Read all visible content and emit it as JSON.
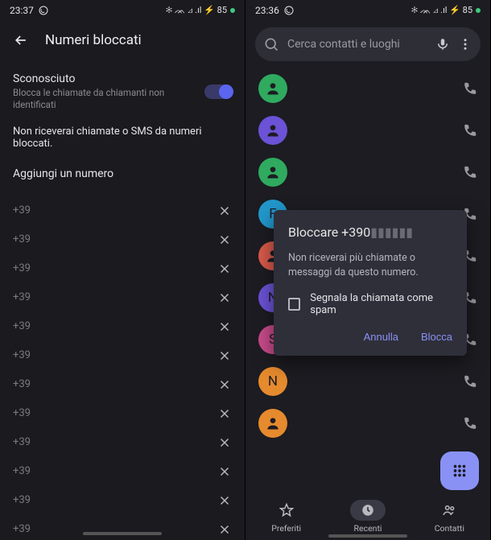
{
  "left": {
    "status": {
      "time": "23:37",
      "icons": "✻ ᨏ ⊿ .ıl ⚡ 85"
    },
    "title": "Numeri bloccati",
    "toggle": {
      "title": "Sconosciuto",
      "subtitle": "Blocca le chiamate da chiamanti non identificati"
    },
    "info": "Non riceverai chiamate o SMS da numeri bloccati.",
    "add_label": "Aggiungi un numero",
    "numbers": [
      "+39",
      "+39",
      "+39",
      "+39",
      "+39",
      "+39",
      "+39",
      "+39",
      "+39",
      "+39",
      "+39",
      "+39"
    ]
  },
  "right": {
    "status": {
      "time": "23:36",
      "icons": "✻ ᨏ ⊿ .ıl ⚡ 85"
    },
    "search_placeholder": "Cerca contatti e luoghi",
    "contacts": [
      {
        "letter": "",
        "color": "#2faa5f"
      },
      {
        "letter": "",
        "color": "#6b52d6"
      },
      {
        "letter": "",
        "color": "#2faa5f"
      },
      {
        "letter": "F",
        "color": "#2298cc"
      },
      {
        "letter": "",
        "color": "#d85a4a"
      },
      {
        "letter": "N",
        "color": "#6b52d6"
      },
      {
        "letter": "S",
        "color": "#c84a8a"
      },
      {
        "letter": "N",
        "color": "#e68a2e"
      },
      {
        "letter": "",
        "color": "#e68a2e"
      }
    ],
    "dialog": {
      "title_prefix": "Bloccare ",
      "title_number": "+390",
      "body": "Non riceverai più chiamate o messaggi da questo numero.",
      "check_label": "Segnala la chiamata come spam",
      "cancel": "Annulla",
      "confirm": "Blocca"
    },
    "nav": {
      "fav": "Preferiti",
      "recent": "Recenti",
      "contacts": "Contatti"
    }
  }
}
